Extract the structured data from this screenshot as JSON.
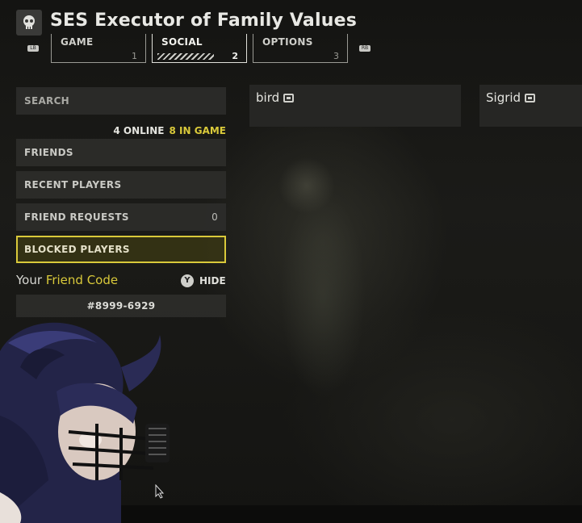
{
  "header": {
    "title": "SES Executor of Family Values",
    "left_hint_key": "LB",
    "right_hint_key": "RB",
    "tabs": [
      {
        "label": "GAME",
        "number": "1",
        "active": false
      },
      {
        "label": "SOCIAL",
        "number": "2",
        "active": true
      },
      {
        "label": "OPTIONS",
        "number": "3",
        "active": false
      }
    ]
  },
  "sidebar": {
    "search_placeholder": "SEARCH",
    "online_text": "4 ONLINE",
    "in_game_text": "8 IN GAME",
    "items": [
      {
        "label": "FRIENDS",
        "count": ""
      },
      {
        "label": "RECENT PLAYERS",
        "count": ""
      },
      {
        "label": "FRIEND REQUESTS",
        "count": "0"
      },
      {
        "label": "BLOCKED PLAYERS",
        "count": ""
      }
    ],
    "friend_code_prefix": "Your",
    "friend_code_accent": "Friend Code",
    "hide_button_key": "Y",
    "hide_label": "HIDE",
    "friend_code": "#8999-6929"
  },
  "players": [
    {
      "name": "bird",
      "platform_icon": "pc-icon"
    },
    {
      "name": "Sigrid",
      "platform_icon": "pc-icon"
    }
  ],
  "colors": {
    "accent": "#d9c93a",
    "panel": "#2c2c2a",
    "background": "#161614"
  }
}
